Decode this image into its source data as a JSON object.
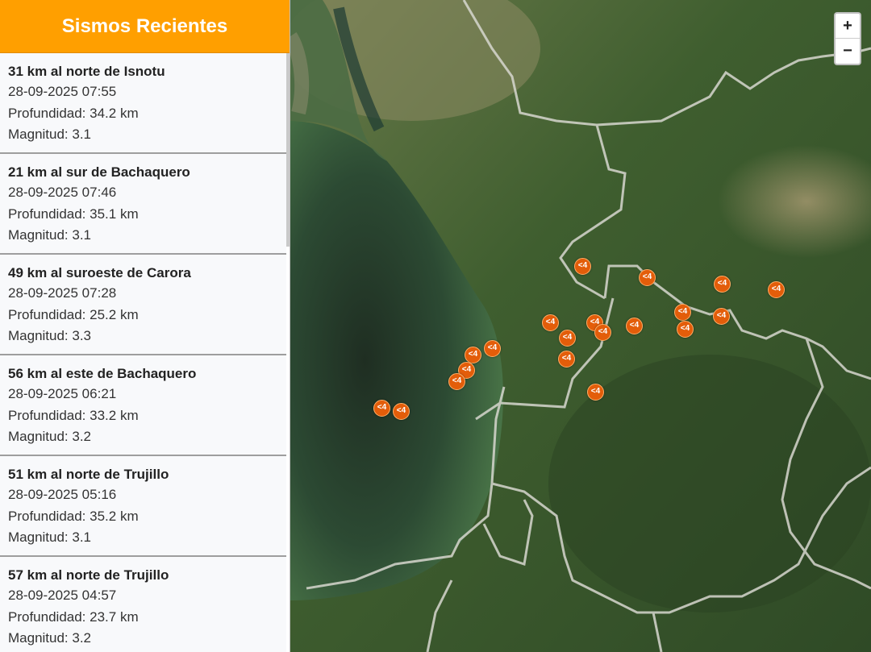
{
  "sidebar": {
    "title": "Sismos Recientes",
    "items": [
      {
        "location": "31 km al norte de Isnotu",
        "datetime": "28-09-2025 07:55",
        "depth": "Profundidad: 34.2 km",
        "magnitude": "Magnitud: 3.1"
      },
      {
        "location": "21 km al sur de Bachaquero",
        "datetime": "28-09-2025 07:46",
        "depth": "Profundidad: 35.1 km",
        "magnitude": "Magnitud: 3.1"
      },
      {
        "location": "49 km al suroeste de Carora",
        "datetime": "28-09-2025 07:28",
        "depth": "Profundidad: 25.2 km",
        "magnitude": "Magnitud: 3.3"
      },
      {
        "location": "56 km al este de Bachaquero",
        "datetime": "28-09-2025 06:21",
        "depth": "Profundidad: 33.2 km",
        "magnitude": "Magnitud: 3.2"
      },
      {
        "location": "51 km al norte de Trujillo",
        "datetime": "28-09-2025 05:16",
        "depth": "Profundidad: 35.2 km",
        "magnitude": "Magnitud: 3.1"
      },
      {
        "location": "57 km al norte de Trujillo",
        "datetime": "28-09-2025 04:57",
        "depth": "Profundidad: 23.7 km",
        "magnitude": "Magnitud: 3.2"
      }
    ]
  },
  "map": {
    "zoom_in_label": "+",
    "zoom_out_label": "−",
    "marker_label": "<4",
    "marker_color": "#e35d0a",
    "marker_count": 22
  }
}
